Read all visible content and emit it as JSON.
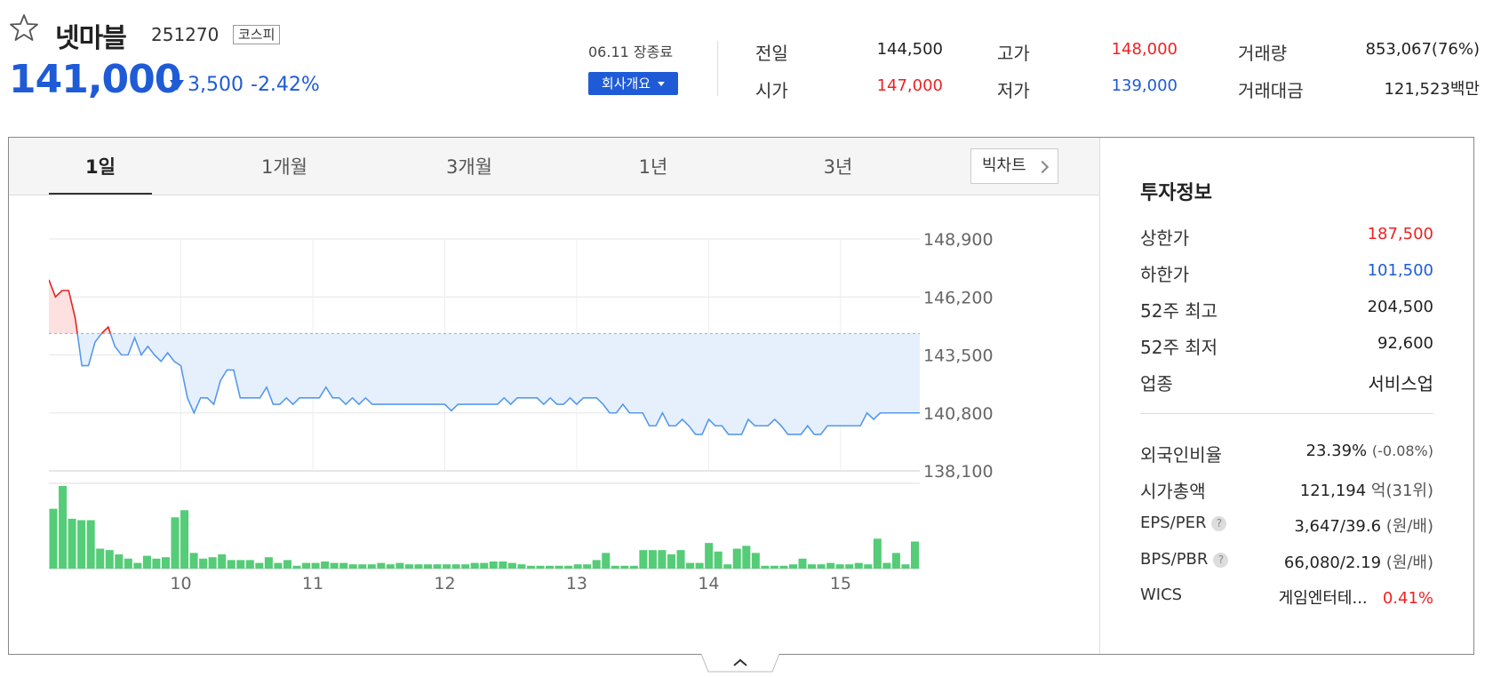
{
  "stock": {
    "name": "넷마블",
    "code": "251270",
    "market": "코스피",
    "price": "141,000",
    "change": "3,500",
    "change_pct": "-2.42%",
    "date_status": "06.11 장종료",
    "company_button": "회사개요"
  },
  "summary": {
    "prev_label": "전일",
    "prev": "144,500",
    "open_label": "시가",
    "open": "147,000",
    "high_label": "고가",
    "high": "148,000",
    "low_label": "저가",
    "low": "139,000",
    "volume_label": "거래량",
    "volume": "853,067(76%)",
    "amount_label": "거래대금",
    "amount": "121,523백만"
  },
  "tabs": [
    "1일",
    "1개월",
    "3개월",
    "1년",
    "3년"
  ],
  "big_chart": "빅차트",
  "info": {
    "title": "투자정보",
    "upper_label": "상한가",
    "upper": "187,500",
    "lower_label": "하한가",
    "lower": "101,500",
    "high52_label": "52주 최고",
    "high52": "204,500",
    "low52_label": "52주 최저",
    "low52": "92,600",
    "sector_label": "업종",
    "sector": "서비스업",
    "foreign_label": "외국인비율",
    "foreign": "23.39%",
    "foreign_chg": "(-0.08%)",
    "mcap_label": "시가총액",
    "mcap": "121,194",
    "mcap_unit": "억(31위)",
    "eps_label": "EPS/PER",
    "eps": "3,647/39.6",
    "eps_unit": "(원/배)",
    "bps_label": "BPS/PBR",
    "bps": "66,080/2.19",
    "bps_unit": "(원/배)",
    "wics_label": "WICS",
    "wics": "게임엔터테...",
    "wics_chg": "0.41%",
    "help_mark": "?"
  },
  "colors": {
    "up": "#e22222",
    "down": "#1f5bd6",
    "volume": "#55cc77",
    "fill_down": "#e6f0fc",
    "fill_up": "#fde0e0"
  },
  "chart_data": {
    "type": "line",
    "y_ticks": [
      "148,900",
      "146,200",
      "143,500",
      "140,800",
      "138,100"
    ],
    "y_tick_values": [
      148900,
      146200,
      143500,
      140800,
      138100
    ],
    "ylim": [
      138100,
      148900
    ],
    "x_ticks": [
      "10",
      "11",
      "12",
      "13",
      "14",
      "15"
    ],
    "x_tick_positions": [
      1.0,
      2.0,
      3.0,
      4.0,
      5.0,
      6.0
    ],
    "x_range": [
      0.0,
      6.6
    ],
    "baseline": 144500,
    "price_x": [
      0.0,
      0.05,
      0.1,
      0.15,
      0.2,
      0.25,
      0.3,
      0.35,
      0.4,
      0.45,
      0.5,
      0.55,
      0.6,
      0.65,
      0.7,
      0.75,
      0.8,
      0.85,
      0.9,
      0.95,
      1.0,
      1.05,
      1.1,
      1.15,
      1.2,
      1.25,
      1.3,
      1.35,
      1.4,
      1.45,
      1.5,
      1.55,
      1.6,
      1.65,
      1.7,
      1.75,
      1.8,
      1.85,
      1.9,
      1.95,
      2.0,
      2.05,
      2.1,
      2.15,
      2.2,
      2.25,
      2.3,
      2.35,
      2.4,
      2.45,
      2.5,
      2.6,
      2.7,
      2.8,
      2.9,
      3.0,
      3.05,
      3.1,
      3.2,
      3.3,
      3.4,
      3.45,
      3.5,
      3.55,
      3.6,
      3.65,
      3.7,
      3.75,
      3.8,
      3.85,
      3.9,
      3.95,
      4.0,
      4.05,
      4.1,
      4.15,
      4.2,
      4.25,
      4.3,
      4.35,
      4.4,
      4.45,
      4.5,
      4.55,
      4.6,
      4.65,
      4.7,
      4.75,
      4.8,
      4.85,
      4.9,
      4.95,
      5.0,
      5.05,
      5.1,
      5.15,
      5.2,
      5.25,
      5.3,
      5.35,
      5.4,
      5.45,
      5.5,
      5.55,
      5.6,
      5.65,
      5.7,
      5.75,
      5.8,
      5.85,
      5.9,
      5.95,
      6.0,
      6.05,
      6.1,
      6.15,
      6.2,
      6.25,
      6.3,
      6.4,
      6.5,
      6.6
    ],
    "price_y": [
      147000,
      146200,
      146500,
      146500,
      145200,
      143000,
      143000,
      144100,
      144500,
      144800,
      143900,
      143500,
      143500,
      144300,
      143500,
      143900,
      143500,
      143200,
      143600,
      143200,
      143000,
      141500,
      140800,
      141500,
      141500,
      141200,
      142300,
      142800,
      142800,
      141500,
      141500,
      141500,
      141500,
      142000,
      141200,
      141200,
      141500,
      141200,
      141500,
      141500,
      141500,
      141500,
      142000,
      141500,
      141500,
      141200,
      141500,
      141200,
      141500,
      141200,
      141200,
      141200,
      141200,
      141200,
      141200,
      141200,
      140900,
      141200,
      141200,
      141200,
      141200,
      141500,
      141200,
      141500,
      141500,
      141500,
      141500,
      141200,
      141500,
      141200,
      141200,
      141500,
      141200,
      141500,
      141500,
      141500,
      141200,
      140800,
      140800,
      141200,
      140800,
      140800,
      140800,
      140200,
      140200,
      140800,
      140200,
      140200,
      140500,
      140200,
      139800,
      139800,
      140500,
      140200,
      140200,
      139800,
      139800,
      139800,
      140500,
      140200,
      140200,
      140200,
      140500,
      140200,
      139800,
      139800,
      139800,
      140200,
      139800,
      139800,
      140200,
      140200,
      140200,
      140200,
      140200,
      140200,
      140800,
      140500,
      140800,
      140800,
      140800,
      140800
    ],
    "volume": [
      42,
      58,
      35,
      34,
      34,
      14,
      13,
      10,
      7,
      4,
      9,
      7,
      8,
      36,
      41,
      11,
      7,
      8,
      10,
      6,
      6,
      6,
      4,
      8,
      4,
      6,
      2,
      4,
      4,
      5,
      4,
      4,
      3,
      3,
      3,
      4,
      3,
      4,
      3,
      3,
      3,
      3,
      3,
      3,
      3,
      4,
      4,
      5,
      5,
      4,
      3,
      2,
      2,
      2,
      2,
      2,
      3,
      3,
      6,
      11,
      2,
      2,
      2,
      13,
      13,
      13,
      10,
      13,
      4,
      4,
      18,
      12,
      3,
      14,
      16,
      11,
      2,
      2,
      2,
      3,
      7,
      3,
      3,
      4,
      3,
      3,
      4,
      3,
      21,
      4,
      11,
      3,
      19
    ]
  }
}
